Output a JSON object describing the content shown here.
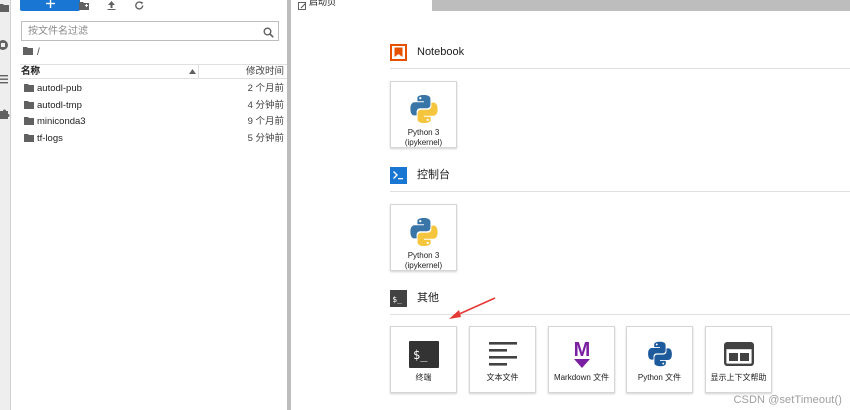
{
  "file_browser": {
    "filter_placeholder": "按文件名过滤",
    "breadcrumb": "/",
    "header_name": "名称",
    "header_modified": "修改时间",
    "items": [
      {
        "name": "autodl-pub",
        "modified": "2 个月前"
      },
      {
        "name": "autodl-tmp",
        "modified": "4 分钟前"
      },
      {
        "name": "miniconda3",
        "modified": "9 个月前"
      },
      {
        "name": "tf-logs",
        "modified": "5 分钟前"
      }
    ]
  },
  "tab": {
    "label": "启动页"
  },
  "launcher": {
    "sections": [
      {
        "title": "Notebook",
        "icon": "notebook-icon",
        "color": "#e65100",
        "cards": [
          {
            "line1": "Python 3",
            "line2": "(ipykernel)",
            "icon": "python-logo-icon"
          }
        ]
      },
      {
        "title": "控制台",
        "icon": "console-icon",
        "color": "#1976d2",
        "cards": [
          {
            "line1": "Python 3",
            "line2": "(ipykernel)",
            "icon": "python-logo-icon"
          }
        ]
      },
      {
        "title": "其他",
        "icon": "terminal-icon",
        "color": "#424242",
        "cards": [
          {
            "line1": "终端",
            "icon": "terminal-icon"
          },
          {
            "line1": "文本文件",
            "icon": "text-file-icon"
          },
          {
            "line1": "Markdown 文件",
            "icon": "markdown-icon"
          },
          {
            "line1": "Python 文件",
            "icon": "python-file-icon"
          },
          {
            "line1": "显示上下文帮助",
            "icon": "context-help-icon"
          }
        ]
      }
    ]
  },
  "colors": {
    "accent": "#1976d2",
    "notebook": "#e65100",
    "markdown": "#7b1fa2",
    "annotation_arrow": "#e53935"
  },
  "watermark": "CSDN @setTimeout()"
}
